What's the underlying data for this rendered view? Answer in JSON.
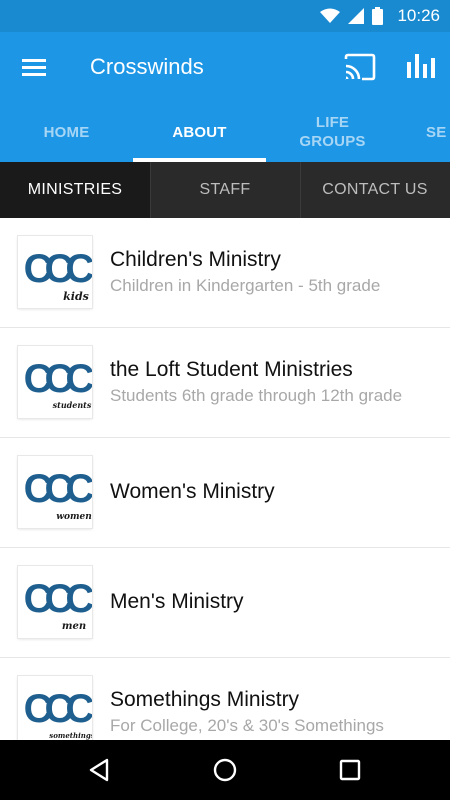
{
  "status_bar": {
    "time": "10:26",
    "icons": [
      "wifi-icon",
      "signal-icon",
      "battery-icon"
    ]
  },
  "app_bar": {
    "title": "Crosswinds",
    "icons": [
      "menu-icon",
      "cast-icon",
      "bar-chart-icon"
    ]
  },
  "tabs": [
    {
      "label": "HOME"
    },
    {
      "label": "ABOUT",
      "active": true
    },
    {
      "label": "LIFE\nGROUPS"
    },
    {
      "label": "SE"
    }
  ],
  "sub_tabs": [
    {
      "label": "MINISTRIES",
      "active": true
    },
    {
      "label": "STAFF"
    },
    {
      "label": "CONTACT US"
    }
  ],
  "ministries": [
    {
      "title": "Children's Ministry",
      "subtitle": "Children in Kindergarten - 5th grade",
      "logo_text": "CCC",
      "logo_tag": "kids"
    },
    {
      "title": "the Loft Student Ministries",
      "subtitle": "Students 6th grade through 12th grade",
      "logo_text": "CCC",
      "logo_tag": "students"
    },
    {
      "title": "Women's Ministry",
      "subtitle": "",
      "logo_text": "CCC",
      "logo_tag": "women"
    },
    {
      "title": "Men's Ministry",
      "subtitle": "",
      "logo_text": "CCC",
      "logo_tag": "men"
    },
    {
      "title": "Somethings Ministry",
      "subtitle": "For College, 20's & 30's Somethings",
      "logo_text": "CCC",
      "logo_tag": "somethings"
    }
  ],
  "nav_bar": {
    "icons": [
      "back-icon",
      "home-icon",
      "recents-icon"
    ]
  },
  "colors": {
    "status_bar": "#1a8ad0",
    "app_bar": "#1e96e6",
    "sub_tabs": "#2a2a2a",
    "logo": "#1f5f8f"
  }
}
